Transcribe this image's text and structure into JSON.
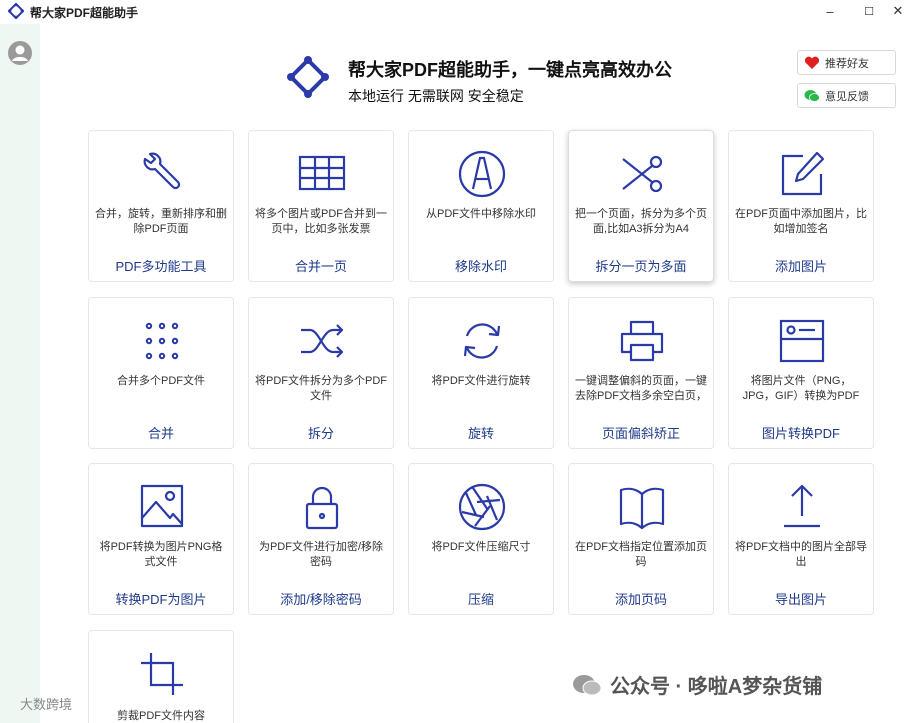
{
  "window": {
    "title": "帮大家PDF超能助手",
    "minimize": "–",
    "maximize": "☐",
    "close": "✕"
  },
  "header": {
    "title": "帮大家PDF超能助手，一键点亮高效办公",
    "subtitle": "本地运行 无需联网 安全稳定",
    "recommend": "推荐好友",
    "feedback": "意见反馈"
  },
  "tools": [
    {
      "title": "PDF多功能工具",
      "desc": "合并，旋转，重新排序和删除PDF页面",
      "icon": "wrench-icon"
    },
    {
      "title": "合并一页",
      "desc": "将多个图片或PDF合并到一页中，比如多张发票",
      "icon": "table-icon"
    },
    {
      "title": "移除水印",
      "desc": "从PDF文件中移除水印",
      "icon": "watermark-icon"
    },
    {
      "title": "拆分一页为多面",
      "desc": "把一个页面，拆分为多个页面,比如A3拆分为A4",
      "icon": "scissors-icon"
    },
    {
      "title": "添加图片",
      "desc": "在PDF页面中添加图片，比如增加签名",
      "icon": "edit-icon"
    },
    {
      "title": "合并",
      "desc": "合并多个PDF文件",
      "icon": "dots-grid-icon"
    },
    {
      "title": "拆分",
      "desc": "将PDF文件拆分为多个PDF文件",
      "icon": "shuffle-icon"
    },
    {
      "title": "旋转",
      "desc": "将PDF文件进行旋转",
      "icon": "rotate-icon"
    },
    {
      "title": "页面偏斜矫正",
      "desc": "一键调整偏斜的页面，一键去除PDF文档多余空白页，",
      "icon": "printer-icon"
    },
    {
      "title": "图片转换PDF",
      "desc": "将图片文件（PNG，JPG，GIF）转换为PDF",
      "icon": "id-card-icon"
    },
    {
      "title": "转换PDF为图片",
      "desc": "将PDF转换为图片PNG格式文件",
      "icon": "image-icon"
    },
    {
      "title": "添加/移除密码",
      "desc": "为PDF文件进行加密/移除密码",
      "icon": "lock-icon"
    },
    {
      "title": "压缩",
      "desc": "将PDF文件压缩尺寸",
      "icon": "aperture-icon"
    },
    {
      "title": "添加页码",
      "desc": "在PDF文档指定位置添加页码",
      "icon": "book-icon"
    },
    {
      "title": "导出图片",
      "desc": "将PDF文档中的图片全部导出",
      "icon": "upload-icon"
    },
    {
      "title": "",
      "desc": "剪裁PDF文件内容",
      "icon": "crop-icon"
    }
  ],
  "watermark": {
    "text": "公众号 · 哆啦A梦杂货铺",
    "small": "大数跨境"
  },
  "colors": {
    "accent": "#1f3a8a",
    "sidebar": "#eef7f1"
  }
}
